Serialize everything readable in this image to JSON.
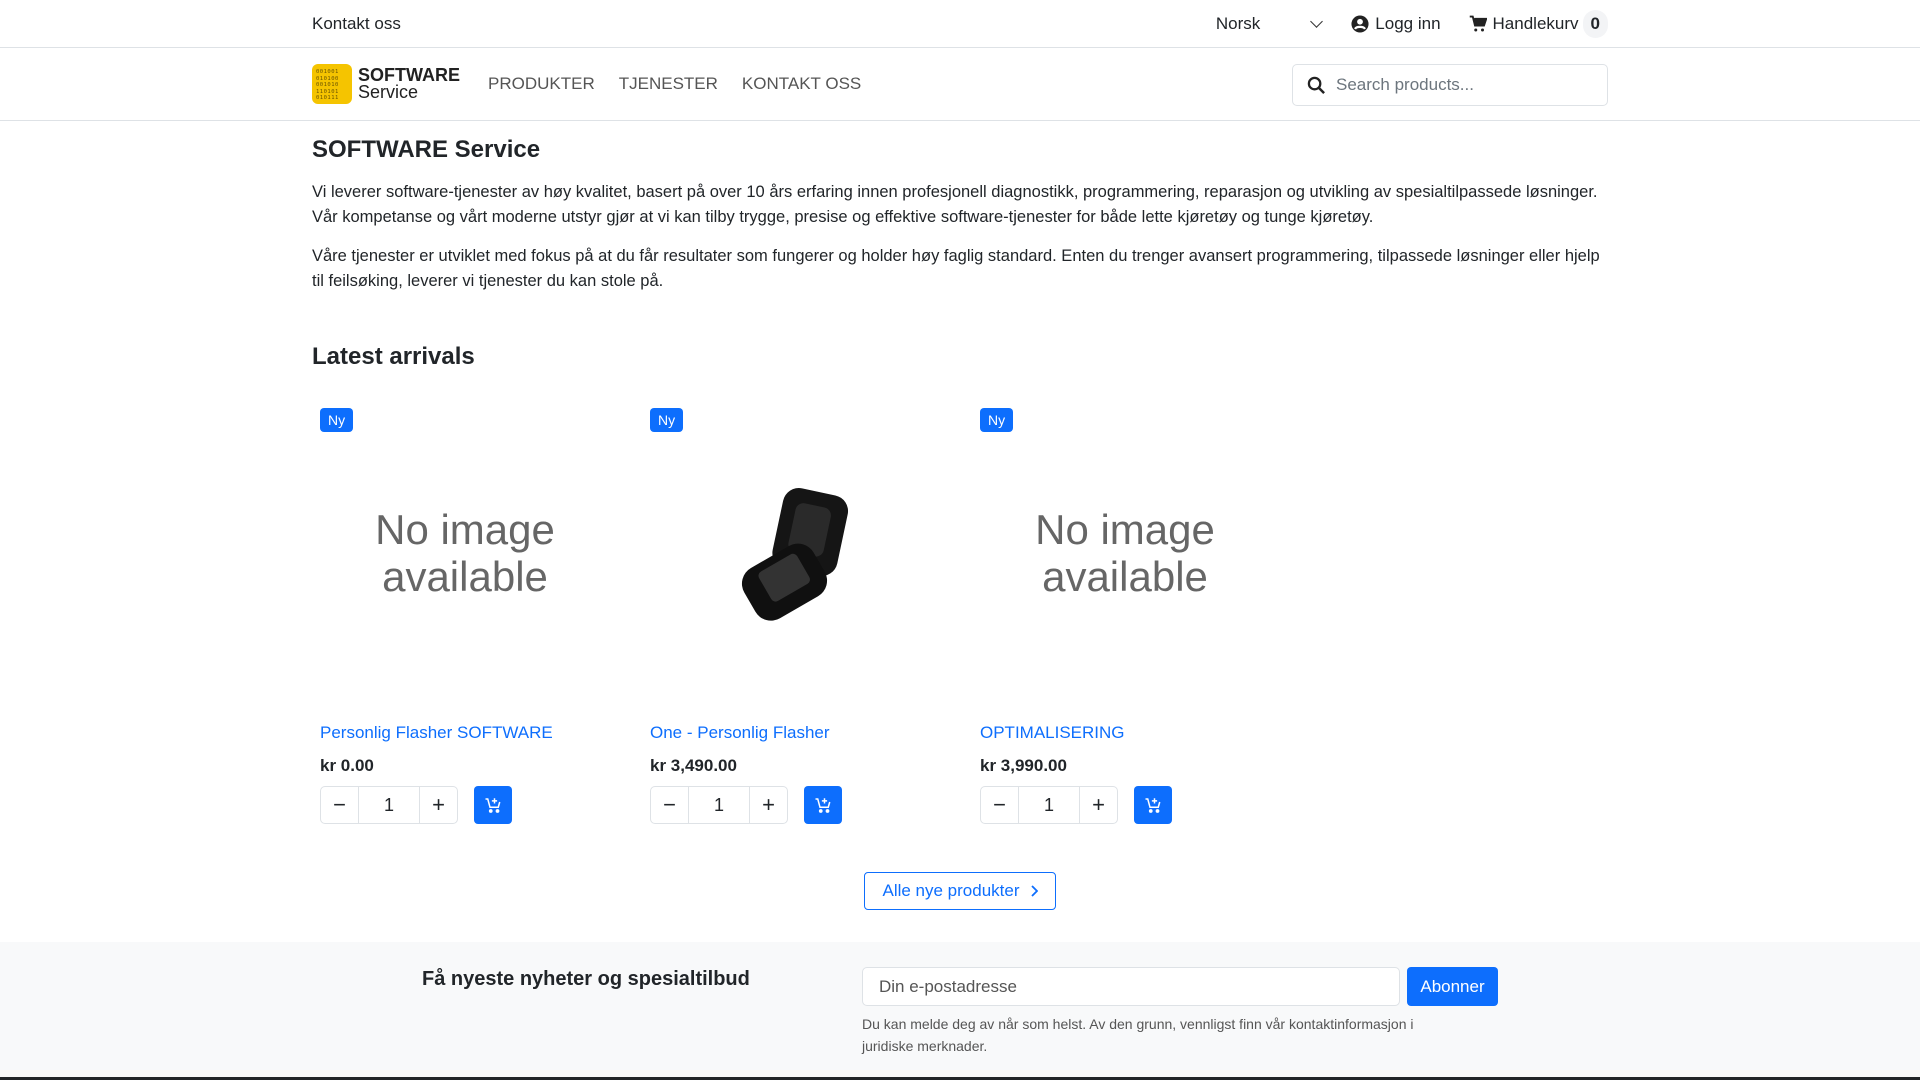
{
  "topbar": {
    "contact": "Kontakt oss",
    "language": "Norsk",
    "login": "Logg inn",
    "cart_label": "Handlekurv",
    "cart_count": "0"
  },
  "nav": {
    "logo_line1": "SOFTWARE",
    "logo_line2": "Service",
    "logo_bits": "001001 010100 001010 110101 010111",
    "items": [
      "PRODUKTER",
      "TJENESTER",
      "KONTAKT OSS"
    ],
    "search_placeholder": "Search products..."
  },
  "main": {
    "title": "SOFTWARE Service",
    "paragraphs": [
      "Vi leverer software-tjenester av høy kvalitet, basert på over 10 års erfaring innen profesjonell diagnostikk, programmering, reparasjon og utvikling av spesialtilpassede løsninger. Vår kompetanse og vårt moderne utstyr gjør at vi kan tilby trygge, presise og effektive software-tjenester for både lette kjøretøy og tunge kjøretøy.",
      "Våre tjenester er utviklet med fokus på at du får resultater som fungerer og holder høy faglig standard. Enten du trenger avansert programmering, tilpassede løsninger eller hjelp til feilsøking, leverer vi tjenester du kan stole på."
    ],
    "latest_title": "Latest arrivals",
    "products": [
      {
        "badge": "Ny",
        "image": "No image available",
        "name": "Personlig Flasher SOFTWARE",
        "price": "kr 0.00",
        "qty": "1"
      },
      {
        "badge": "Ny",
        "image": "product-photo",
        "name": "One - Personlig Flasher",
        "price": "kr 3,490.00",
        "qty": "1"
      },
      {
        "badge": "Ny",
        "image": "No image available",
        "name": "OPTIMALISERING",
        "price": "kr 3,990.00",
        "qty": "1"
      }
    ],
    "all_new": "Alle nye produkter"
  },
  "footer": {
    "heading": "Få nyeste nyheter og spesialtilbud",
    "email_placeholder": "Din e-postadresse",
    "subscribe": "Abonner",
    "note": "Du kan melde deg av når som helst. Av den grunn, vennligst finn vår kontaktinformasjon i juridiske merknader."
  },
  "colors": {
    "primary": "#0d6efd",
    "logo": "#f5c400"
  }
}
